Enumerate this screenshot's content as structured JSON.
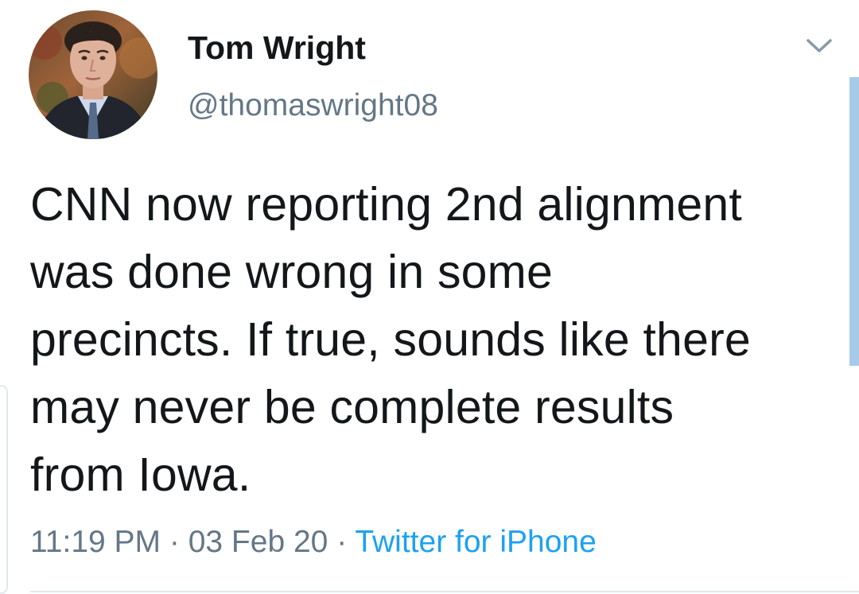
{
  "tweet": {
    "author": {
      "display_name": "Tom Wright",
      "handle": "@thomaswright08"
    },
    "text": "CNN now reporting 2nd alignment\nwas done wrong in some\nprecincts. If true, sounds like there\nmay never be complete results\nfrom Iowa.",
    "time": "11:19 PM",
    "date": "03 Feb 20",
    "separator": " · ",
    "source": "Twitter for iPhone"
  },
  "icons": {
    "menu": "chevron-down-icon",
    "avatar": "avatar"
  },
  "colors": {
    "text": "#14171a",
    "secondary_text": "#657786",
    "link": "#1da1f2",
    "scroll_indicator": "#a6cbe8",
    "divider": "#e1e8ed"
  }
}
